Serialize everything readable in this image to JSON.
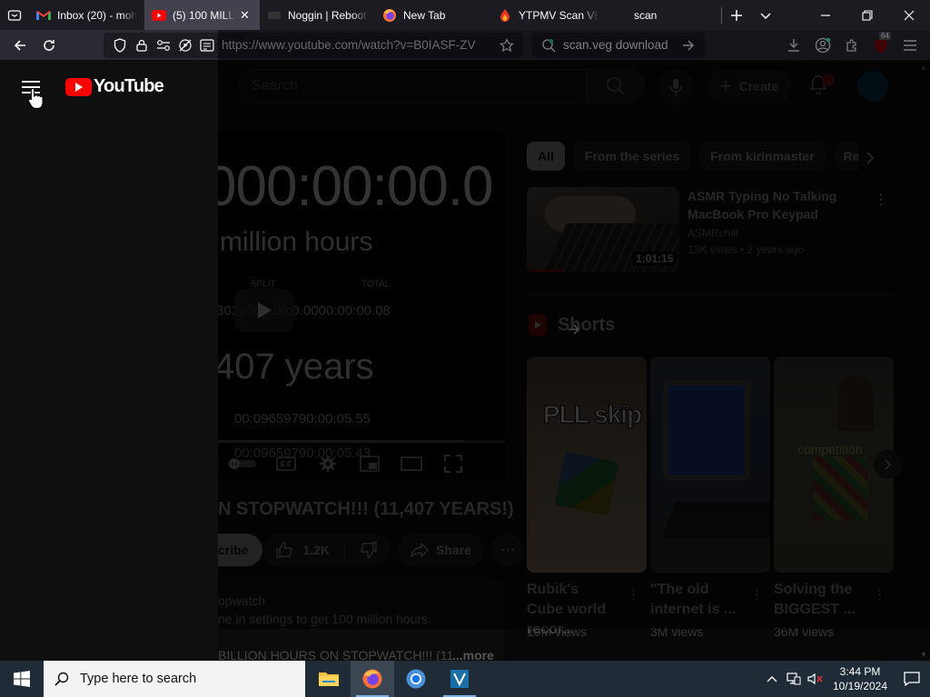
{
  "browser": {
    "tabs": [
      {
        "title": "Inbox (20) - moh",
        "favicon": "gmail-icon",
        "active": false
      },
      {
        "title": "(5) 100 MILLIO",
        "favicon": "youtube-icon",
        "active": true
      },
      {
        "title": "Noggin | Reboot",
        "favicon": "noggin-icon",
        "active": false
      },
      {
        "title": "New Tab",
        "favicon": "firefox-icon",
        "active": false
      },
      {
        "title": "YTPMV Scan VEG",
        "favicon": "vegas-icon",
        "active": false
      },
      {
        "title": "scan",
        "favicon": "none",
        "active": false
      }
    ],
    "url": "https://www.youtube.com/watch?v=B0IASF-ZV",
    "search_text": "scan.veg download",
    "extension_badge": "64",
    "colors": {
      "tabbar_bg": "#1c1b22",
      "navbar_bg": "#2b2a33",
      "active_tab": "#42414d"
    }
  },
  "youtube": {
    "logo_text": "YouTube",
    "search_placeholder": "Search",
    "create_label": "Create",
    "brand_color": "#ff0000",
    "player": {
      "big_time": "000:00:00.0",
      "million_hours": "million hours",
      "split_label": "SPLIT",
      "total_label": "TOTAL",
      "row1": "3012000:00:0.0000:00:00.08",
      "years": "407 years",
      "row2": "00:09659790:00:05.55",
      "row3": "00:09659790:00:05.43",
      "progress_pct": 85
    },
    "video_title": "N STOPWATCH!!! (11,407 YEARS!)",
    "subscribe_label": "cribe",
    "like_count": "1.2K",
    "share_label": "Share",
    "description": {
      "channel_line": "opwatch",
      "line2": "ne in settings to get 100 million hours.",
      "line3": "BILLION HOURS ON STOPWATCH!!! (114",
      "more": "...more"
    },
    "chips": [
      "All",
      "From the series",
      "From kirinmaster",
      "Re"
    ],
    "recommendation": {
      "title": "ASMR Typing No Talking MacBook Pro Keypad",
      "channel": "ASMRchill",
      "meta": "13K views • 2 years ago",
      "duration": "1:01:15"
    },
    "shorts_heading": "Shorts",
    "shorts": [
      {
        "caption": "PLL skip",
        "title": "Rubik's Cube world recor...",
        "views": "10M views"
      },
      {
        "caption": "",
        "title": "\"The old internet is ...",
        "views": "3M views"
      },
      {
        "caption": "competition",
        "title": "Solving the BIGGEST ...",
        "views": "36M views"
      }
    ]
  },
  "taskbar": {
    "search_placeholder": "Type here to search",
    "time": "3:44 PM",
    "date": "10/19/2024",
    "apps": [
      "file-explorer-icon",
      "firefox-icon",
      "chrome-icon",
      "vegas-icon"
    ]
  }
}
